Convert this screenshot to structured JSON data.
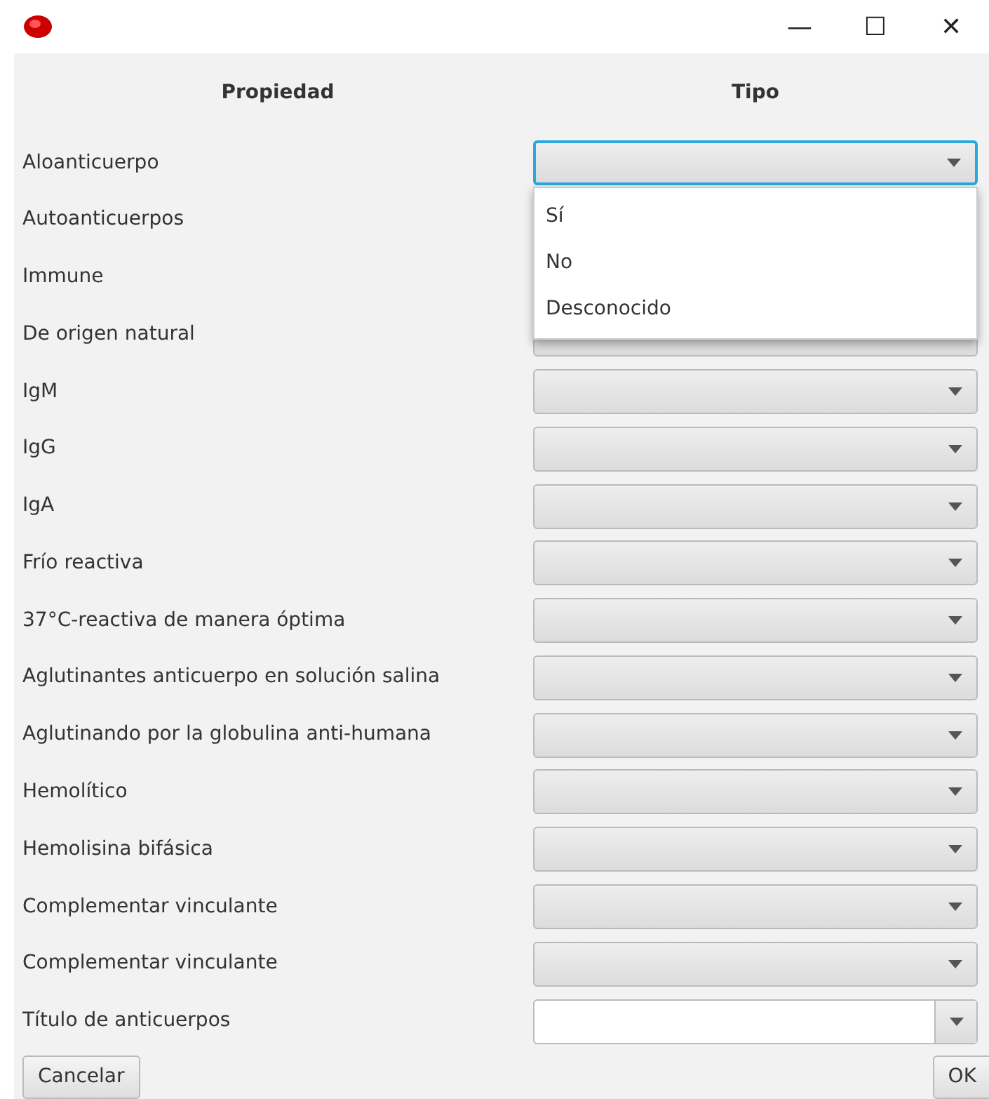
{
  "window": {
    "controls": [
      "—",
      "☐",
      "✕"
    ]
  },
  "header": {
    "property": "Propiedad",
    "type": "Tipo"
  },
  "rows": [
    {
      "label": "Aloanticuerpo",
      "kind": "combo",
      "open": true
    },
    {
      "label": "Autoanticuerpos"
    },
    {
      "label": "Immune"
    },
    {
      "label": "De origen natural",
      "kind": "combo",
      "open": false
    },
    {
      "label": "IgM",
      "kind": "combo",
      "open": false
    },
    {
      "label": "IgG",
      "kind": "combo",
      "open": false
    },
    {
      "label": "IgA",
      "kind": "combo",
      "open": false
    },
    {
      "label": "Frío reactiva",
      "kind": "combo",
      "open": false
    },
    {
      "label": "37°C-reactiva de manera óptima",
      "kind": "combo",
      "open": false
    },
    {
      "label": "Aglutinantes anticuerpo en solución salina",
      "kind": "combo",
      "open": false
    },
    {
      "label": "Aglutinando por la globulina anti-humana",
      "kind": "combo",
      "open": false
    },
    {
      "label": "Hemolítico",
      "kind": "combo",
      "open": false
    },
    {
      "label": "Hemolisina bifásica",
      "kind": "combo",
      "open": false
    },
    {
      "label": "Complementar vinculante",
      "kind": "combo",
      "open": false
    },
    {
      "label": "Complementar vinculante",
      "kind": "combo",
      "open": false
    },
    {
      "label": "Título de anticuerpos",
      "kind": "editable",
      "open": false
    }
  ],
  "dropdown": {
    "options": [
      "Sí",
      "No",
      "Desconocido"
    ]
  },
  "buttons": [
    "Cancelar",
    "OK"
  ]
}
